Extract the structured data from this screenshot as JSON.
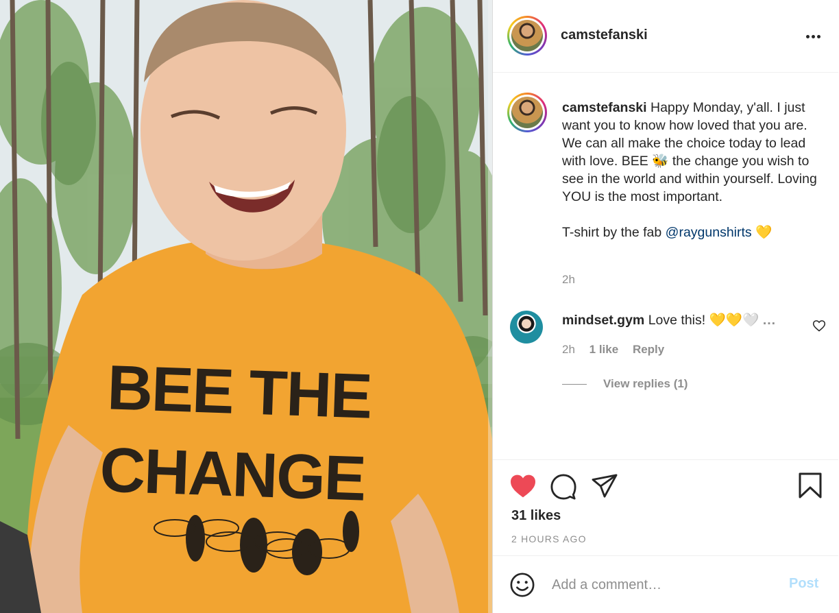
{
  "photo": {
    "shirt_line_1": "BEE THE",
    "shirt_line_2": "CHANGE"
  },
  "header": {
    "username": "camstefanski",
    "more_icon": "more-horizontal-icon"
  },
  "caption": {
    "username": "camstefanski",
    "text_before_emoji": " Happy Monday, y'all. I just want you to know how loved that you are. We can all make the choice today to lead with love. BEE ",
    "emoji_1": "🐝",
    "text_after_emoji": " the change you wish to see in the world and within yourself. Loving YOU is the most important.\n\nT-shirt by the fab ",
    "mention": "@raygunshirts",
    "emoji_2": " 💛",
    "time": "2h"
  },
  "comment": {
    "username": "mindset.gym",
    "text": " Love this! 💛💛🤍",
    "more": "...",
    "time": "2h",
    "likes": "1 like",
    "reply": "Reply",
    "view_replies": "View replies (1)"
  },
  "actions": {
    "likes": "31 likes",
    "timestamp": "2 HOURS AGO",
    "like_color": "#ed4956"
  },
  "add_comment": {
    "placeholder": "Add a comment…",
    "post_label": "Post"
  }
}
